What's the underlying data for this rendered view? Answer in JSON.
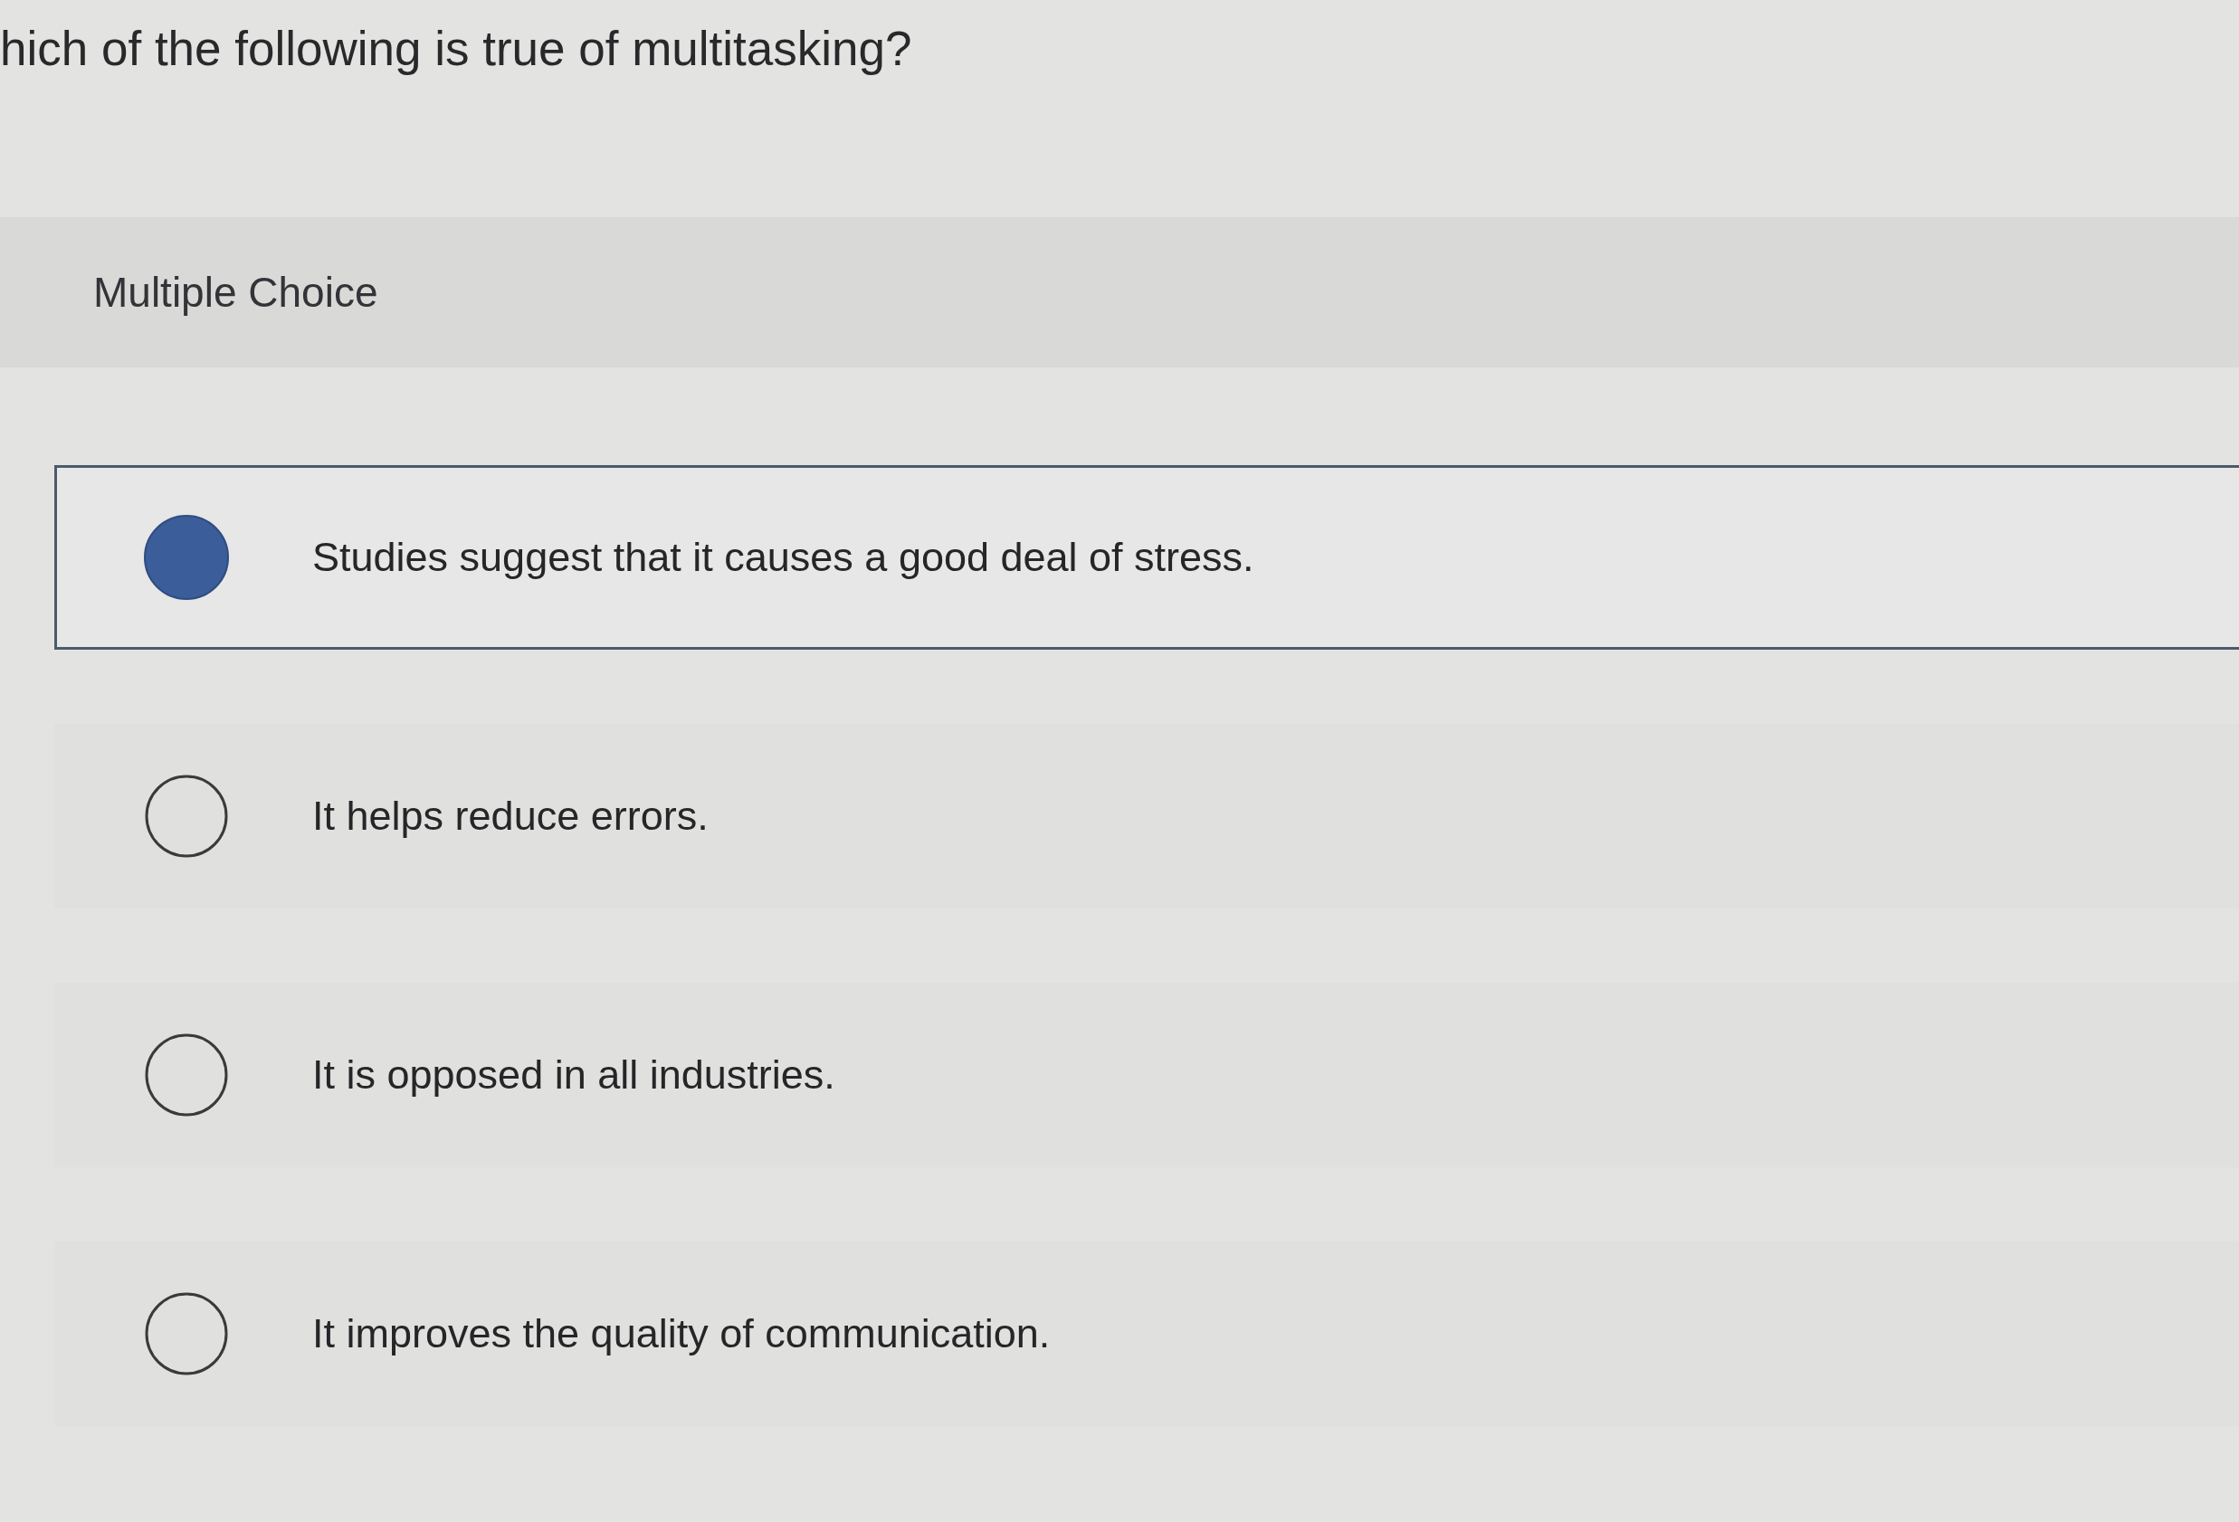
{
  "question": "hich of the following is true of multitasking?",
  "question_type": "Multiple Choice",
  "options": [
    {
      "text": "Studies suggest that it causes a good deal of stress.",
      "selected": true
    },
    {
      "text": "It helps reduce errors.",
      "selected": false
    },
    {
      "text": "It is opposed in all industries.",
      "selected": false
    },
    {
      "text": "It improves the quality of communication.",
      "selected": false
    }
  ]
}
